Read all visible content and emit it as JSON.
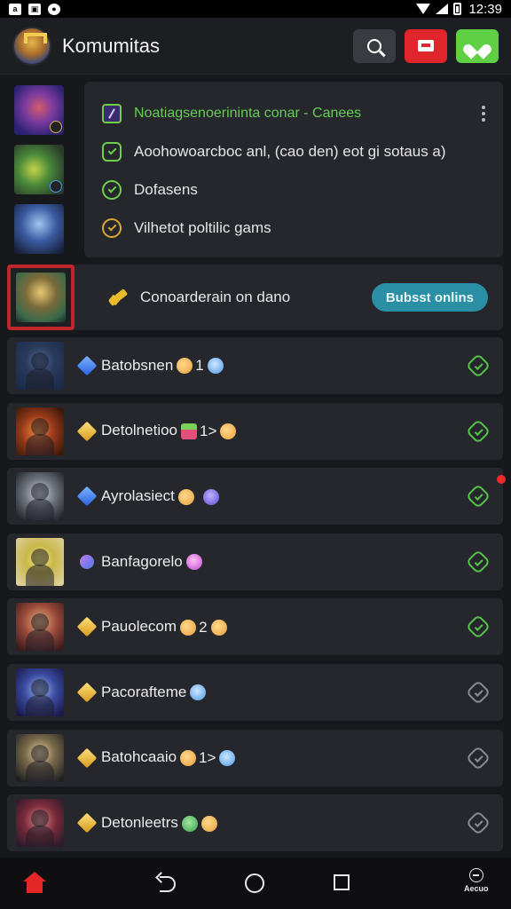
{
  "status_bar": {
    "time": "12:39",
    "icons": [
      "notification-icon",
      "gallery-icon",
      "chat-icon",
      "wifi-icon",
      "signal-icon",
      "battery-icon"
    ]
  },
  "header": {
    "title": "Komumitas",
    "actions": [
      "search-icon",
      "video-icon",
      "heart-icon"
    ],
    "colors": {
      "search": "#3a3b40",
      "red": "#e0262b",
      "green": "#5fd044"
    }
  },
  "info_card": {
    "rows": [
      {
        "icon": "pen-icon",
        "text": "Noatiagsenoerininta conar - Canees"
      },
      {
        "icon": "check-badge-icon",
        "text": "Aoohowoarcboc anl, (cao den) eot gi sotaus a)"
      },
      {
        "icon": "check-badge-icon",
        "text": "Dofasens"
      },
      {
        "icon": "gold-badge-icon",
        "text": "Vilhetot poltilic gams"
      }
    ]
  },
  "featured": {
    "text": "Conoarderain on dano",
    "button": "Bubsst onlins"
  },
  "list": [
    {
      "name": "Batobsnen",
      "count": "1",
      "status": "online"
    },
    {
      "name": "Detolnetioo",
      "count": "1>",
      "status": "online"
    },
    {
      "name": "Ayrolasiect",
      "count": "",
      "status": "online",
      "new": true
    },
    {
      "name": "Banfagorelo",
      "count": "",
      "status": "online"
    },
    {
      "name": "Pauolecom",
      "count": "2",
      "status": "online"
    },
    {
      "name": "Pacorafteme",
      "count": "",
      "status": "offline"
    },
    {
      "name": "Batohcaaio",
      "count": "1>",
      "status": "offline"
    },
    {
      "name": "Detonleetrs",
      "count": "",
      "status": "offline"
    }
  ],
  "nav": {
    "items": [
      "home-icon",
      "back-icon",
      "circle-icon",
      "square-icon"
    ],
    "account_label": "Aecuo"
  }
}
